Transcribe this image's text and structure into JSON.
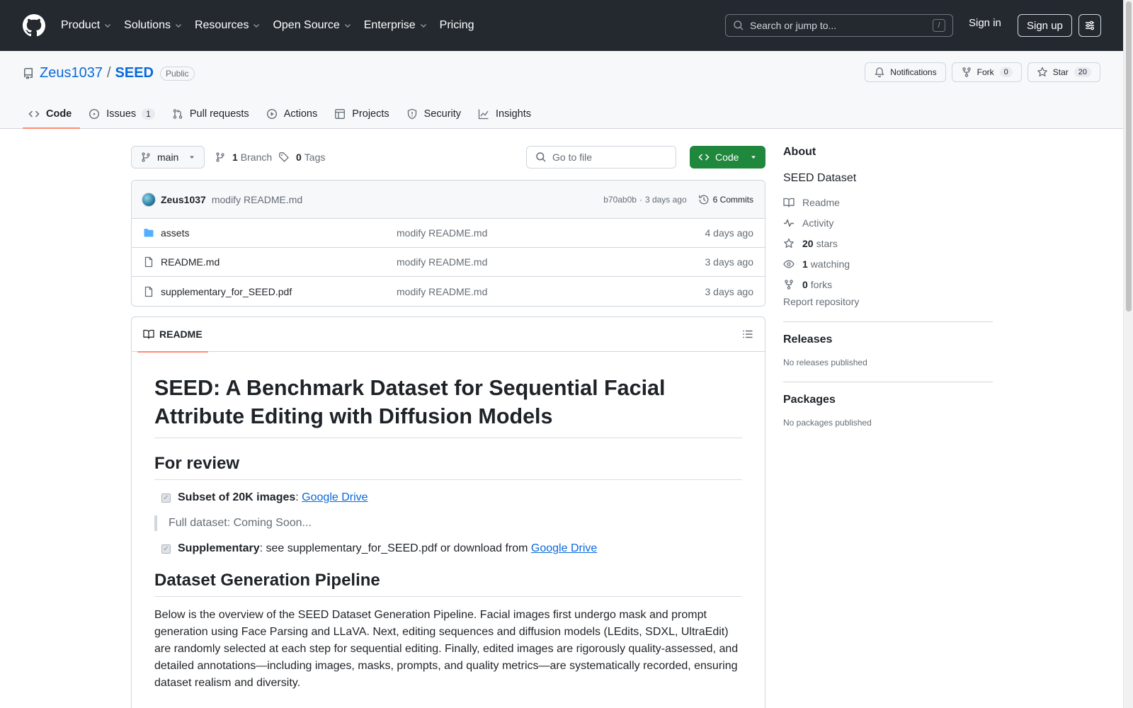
{
  "header": {
    "nav": [
      "Product",
      "Solutions",
      "Resources",
      "Open Source",
      "Enterprise",
      "Pricing"
    ],
    "search_placeholder": "Search or jump to...",
    "search_shortcut": "/",
    "sign_in": "Sign in",
    "sign_up": "Sign up"
  },
  "repo": {
    "owner": "Zeus1037",
    "separator": "/",
    "name": "SEED",
    "visibility": "Public",
    "notifications_label": "Notifications",
    "fork_label": "Fork",
    "fork_count": "0",
    "star_label": "Star",
    "star_count": "20"
  },
  "tabs": {
    "code": "Code",
    "issues": "Issues",
    "issues_count": "1",
    "pulls": "Pull requests",
    "actions": "Actions",
    "projects": "Projects",
    "security": "Security",
    "insights": "Insights"
  },
  "filenav": {
    "branch": "main",
    "branch_count": "1",
    "branch_label": "Branch",
    "tag_count": "0",
    "tag_label": "Tags",
    "goto_placeholder": "Go to file",
    "code_button": "Code"
  },
  "commit": {
    "author": "Zeus1037",
    "message": "modify README.md",
    "hash": "b70ab0b",
    "dot": "·",
    "time": "3 days ago",
    "commits": "6 Commits"
  },
  "files": [
    {
      "name": "assets",
      "type": "folder",
      "message": "modify README.md",
      "date": "4 days ago"
    },
    {
      "name": "README.md",
      "type": "file",
      "message": "modify README.md",
      "date": "3 days ago"
    },
    {
      "name": "supplementary_for_SEED.pdf",
      "type": "file",
      "message": "modify README.md",
      "date": "3 days ago"
    }
  ],
  "readme": {
    "tab": "README",
    "title": "SEED: A Benchmark Dataset for Sequential Facial Attribute Editing with Diffusion Models",
    "h_review": "For review",
    "task1_bold": "Subset of 20K images",
    "task1_sep": ": ",
    "task1_link": "Google Drive",
    "quote": "Full dataset: Coming Soon...",
    "task2_bold": "Supplementary",
    "task2_text": ": see supplementary_for_SEED.pdf or download from ",
    "task2_link": "Google Drive",
    "h_pipeline": "Dataset Generation Pipeline",
    "pipeline_text": "Below is the overview of the SEED Dataset Generation Pipeline. Facial images first undergo mask and prompt generation using Face Parsing and LLaVA. Next, editing sequences and diffusion models (LEdits, SDXL, UltraEdit) are randomly selected at each step for sequential editing. Finally, edited images are rigorously quality-assessed, and detailed annotations—including images, masks, prompts, and quality metrics—are systematically recorded, ensuring dataset realism and diversity."
  },
  "about": {
    "heading": "About",
    "description": "SEED Dataset",
    "readme": "Readme",
    "activity": "Activity",
    "stars_count": "20",
    "stars_label": "stars",
    "watching_count": "1",
    "watching_label": "watching",
    "forks_count": "0",
    "forks_label": "forks",
    "report": "Report repository",
    "releases_heading": "Releases",
    "releases_none": "No releases published",
    "packages_heading": "Packages",
    "packages_none": "No packages published"
  },
  "colors": {
    "header_bg": "#24292f",
    "link": "#0969da",
    "green_button": "#1f883d",
    "active_tab_underline": "#fd8c73"
  }
}
